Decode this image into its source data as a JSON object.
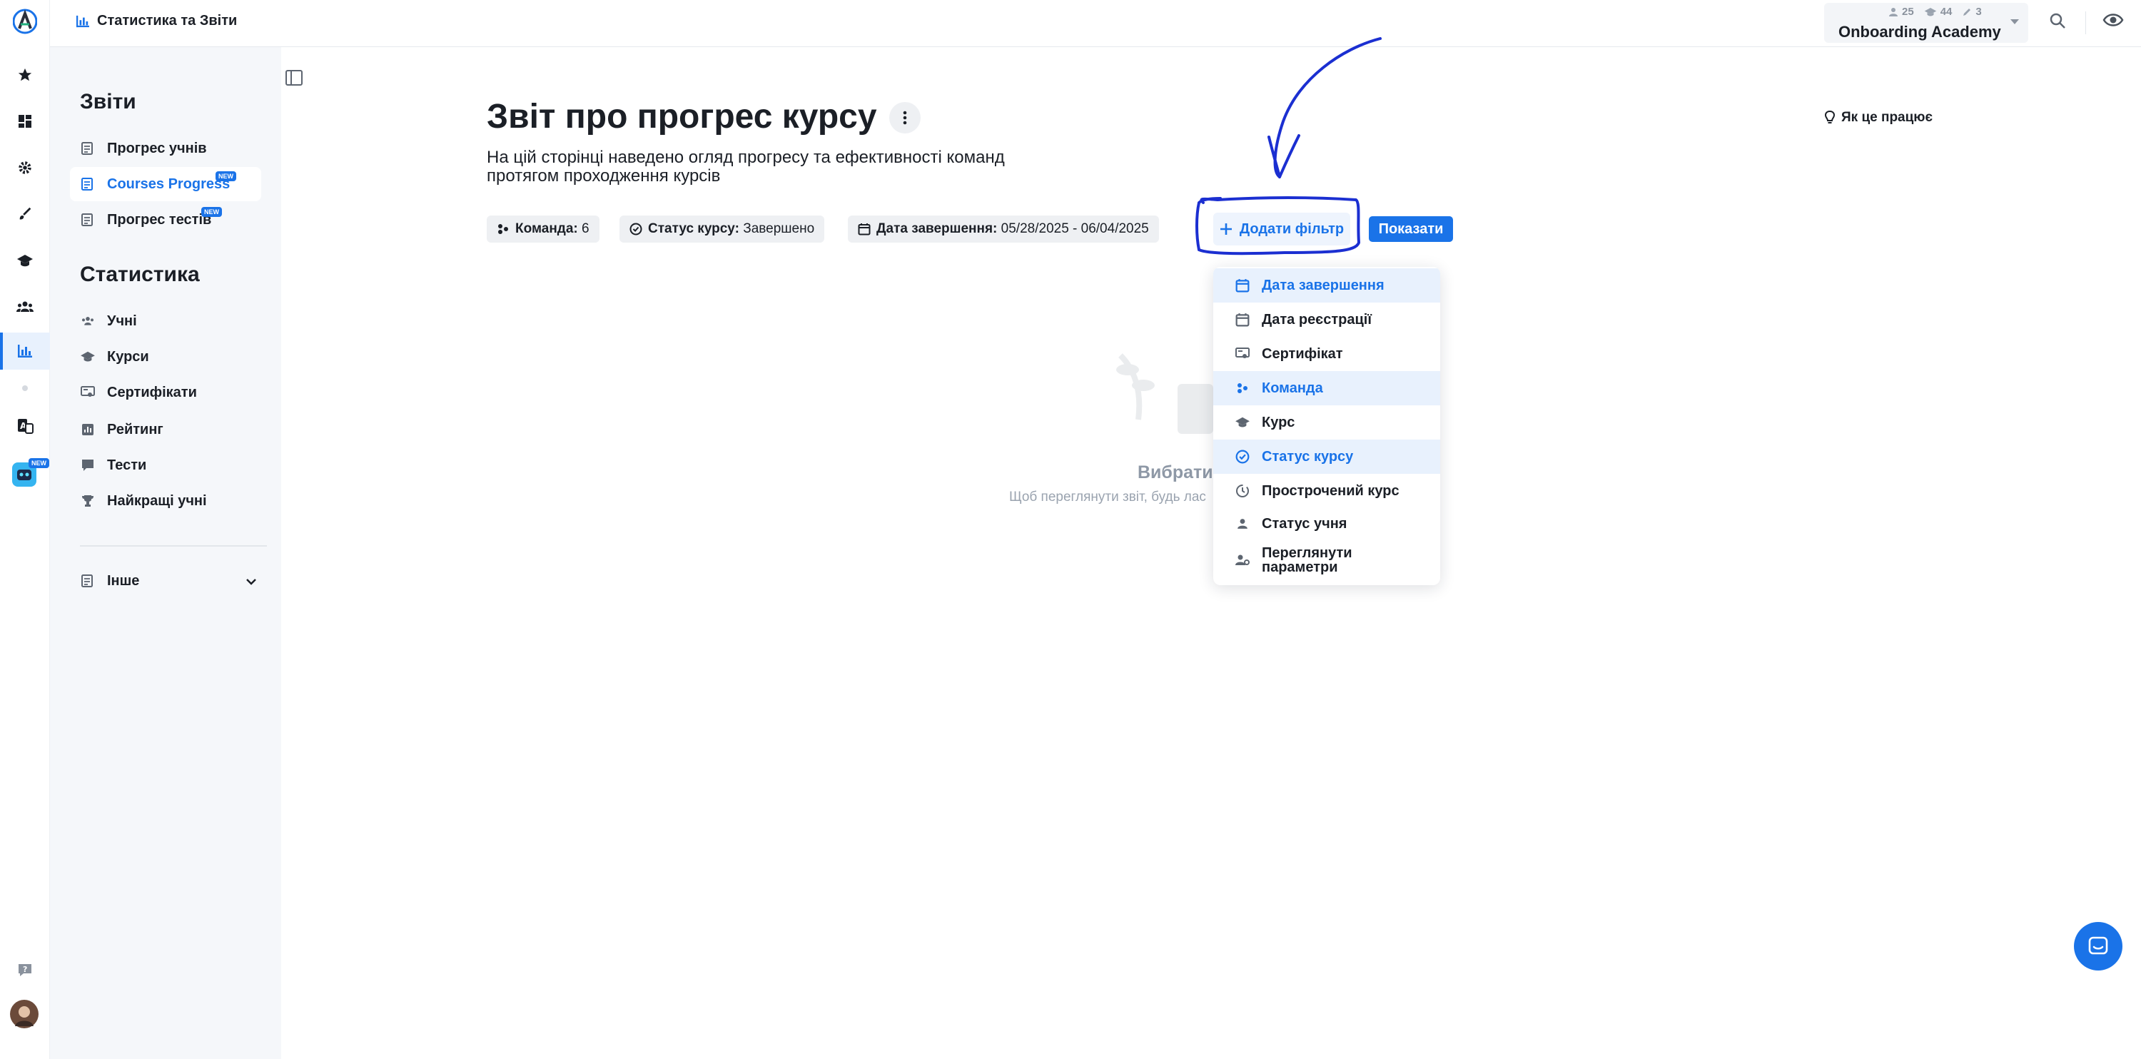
{
  "breadcrumb": {
    "title": "Статистика та Звіти"
  },
  "account": {
    "name": "Onboarding Academy",
    "users_count": "25",
    "courses_count": "44",
    "edits_count": "3"
  },
  "sidebar": {
    "reports_heading": "Звіти",
    "reports": [
      {
        "label": "Прогрес учнів",
        "icon": "report-icon"
      },
      {
        "label": "Courses Progress",
        "icon": "report-icon",
        "badge": "NEW",
        "active": true
      },
      {
        "label": "Прогрес тестів",
        "icon": "report-icon",
        "badge": "NEW"
      }
    ],
    "stats_heading": "Статистика",
    "stats": [
      {
        "label": "Учні",
        "icon": "users-icon"
      },
      {
        "label": "Курси",
        "icon": "course-icon"
      },
      {
        "label": "Сертифікати",
        "icon": "certificate-icon"
      },
      {
        "label": "Рейтинг",
        "icon": "rating-icon"
      },
      {
        "label": "Тести",
        "icon": "test-icon"
      },
      {
        "label": "Найкращі учні",
        "icon": "trophy-icon"
      }
    ],
    "other": {
      "label": "Інше",
      "icon": "report-icon"
    }
  },
  "rail": {
    "new_badge": "NEW"
  },
  "main": {
    "title": "Звіт про прогрес курсу",
    "subtitle": "На цій сторінці наведено огляд прогресу та ефективності команд протягом проходження курсів",
    "how_it_works": "Як це працює",
    "filters": [
      {
        "label": "Команда:",
        "value": "6",
        "icon": "team-icon"
      },
      {
        "label": "Статус курсу:",
        "value": "Завершено",
        "icon": "check-circle-icon"
      },
      {
        "label": "Дата завершення:",
        "value": "05/28/2025 - 06/04/2025",
        "icon": "calendar-icon"
      }
    ],
    "add_filter": "Додати фільтр",
    "show": "Показати",
    "empty_title": "Вибрати",
    "empty_text": "Щоб переглянути звіт, будь лас"
  },
  "dropdown": {
    "items": [
      {
        "label": "Дата завершення",
        "icon": "calendar-icon",
        "selected": true
      },
      {
        "label": "Дата реєстрації",
        "icon": "calendar-icon",
        "selected": false
      },
      {
        "label": "Сертифікат",
        "icon": "certificate-icon",
        "selected": false
      },
      {
        "label": "Команда",
        "icon": "team-icon",
        "selected": true
      },
      {
        "label": "Курс",
        "icon": "course-icon",
        "selected": false
      },
      {
        "label": "Статус курсу",
        "icon": "check-circle-icon",
        "selected": true
      },
      {
        "label": "Прострочений курс",
        "icon": "clock-icon",
        "selected": false
      },
      {
        "label": "Статус учня",
        "icon": "person-icon",
        "selected": false
      },
      {
        "label": "Переглянути параметри",
        "label_line1": "Переглянути",
        "label_line2": "параметри",
        "icon": "person-settings-icon",
        "selected": false
      }
    ]
  },
  "colors": {
    "accent": "#1a73e8",
    "annotation": "#1b2fd1",
    "selected_bg": "#e8f1fd"
  }
}
